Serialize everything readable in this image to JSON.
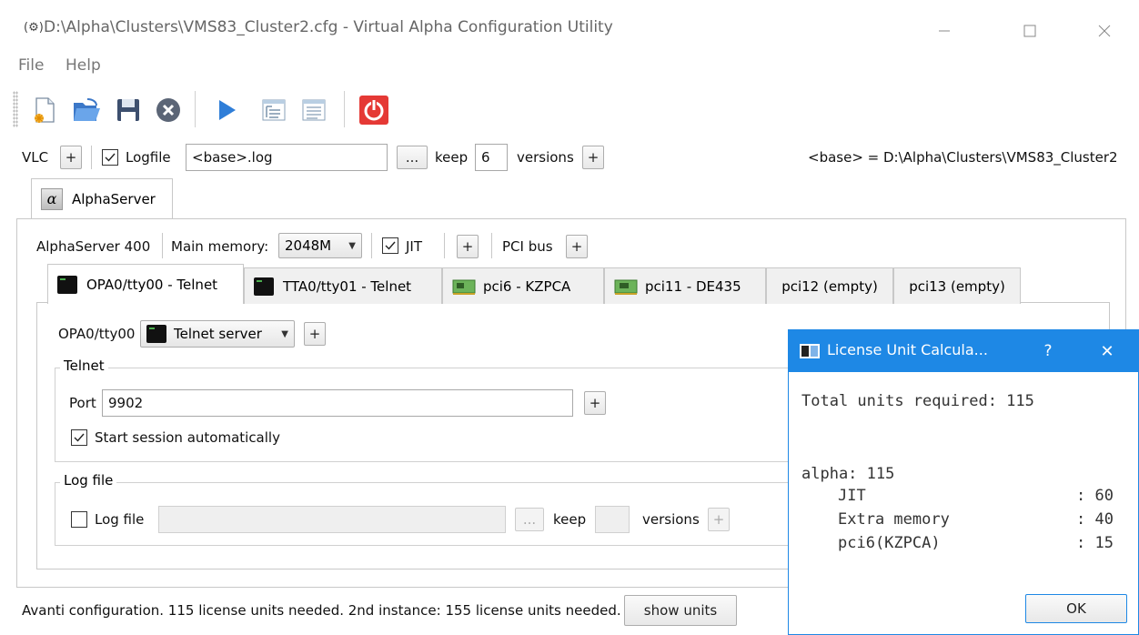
{
  "window": {
    "title": "D:\\Alpha\\Clusters\\VMS83_Cluster2.cfg - Virtual Alpha Configuration Utility",
    "icon_text": "(⚙)",
    "minimize_icon": "minimize-icon",
    "maximize_icon": "maximize-icon",
    "close_icon": "close-icon"
  },
  "menu": {
    "file": "File",
    "help": "Help"
  },
  "toolbar": {
    "buttons": [
      "new-file-icon",
      "open-folder-icon",
      "save-icon",
      "stop-icon",
      "play-icon",
      "tree-icon",
      "details-icon",
      "power-icon"
    ]
  },
  "top_row": {
    "vlc_label": "VLC",
    "plus": "+",
    "logfile_label": "Logfile",
    "logfile_checked": true,
    "logfile_value": "<base>.log",
    "browse": "...",
    "keep_label": "keep",
    "keep_value": "6",
    "versions_label": "versions",
    "base_info": "<base> = D:\\Alpha\\Clusters\\VMS83_Cluster2"
  },
  "outer_tab": {
    "label": "AlphaServer",
    "icon_glyph": "α"
  },
  "server_row": {
    "model": "AlphaServer 400",
    "memory_label": "Main memory:",
    "memory_value": "2048M",
    "jit_label": "JIT",
    "jit_checked": true,
    "plus": "+",
    "pci_label": "PCI bus"
  },
  "inner_tabs": [
    {
      "label": "OPA0/tty00 - Telnet",
      "icon": "terminal-icon"
    },
    {
      "label": "TTA0/tty01 - Telnet",
      "icon": "terminal-icon"
    },
    {
      "label": "pci6 - KZPCA",
      "icon": "pci-card-icon"
    },
    {
      "label": "pci11 - DE435",
      "icon": "pci-card-icon"
    },
    {
      "label": "pci12 (empty)"
    },
    {
      "label": "pci13 (empty)"
    }
  ],
  "device": {
    "name": "OPA0/tty00",
    "type_value": "Telnet server",
    "plus": "+"
  },
  "telnet_group": {
    "title": "Telnet",
    "port_label": "Port",
    "port_value": "9902",
    "plus": "+",
    "autostart_label": "Start session automatically",
    "autostart_checked": true
  },
  "log_group": {
    "title": "Log file",
    "logfile_label": "Log file",
    "logfile_checked": false,
    "logfile_value": "",
    "browse": "...",
    "keep_label": "keep",
    "keep_value": "",
    "versions_label": "versions",
    "plus": "+"
  },
  "status": {
    "text": "Avanti configuration. 115 license units needed. 2nd instance: 155 license units needed.",
    "show_units": "show units"
  },
  "dialog": {
    "title": "License Unit Calcula...",
    "help": "?",
    "close": "✕",
    "total_line": "Total units required: 115",
    "section": "alpha: 115",
    "items": [
      {
        "name": "JIT",
        "value": ": 60"
      },
      {
        "name": "Extra memory",
        "value": ": 40"
      },
      {
        "name": "pci6(KZPCA)",
        "value": ": 15"
      }
    ],
    "ok": "OK"
  }
}
